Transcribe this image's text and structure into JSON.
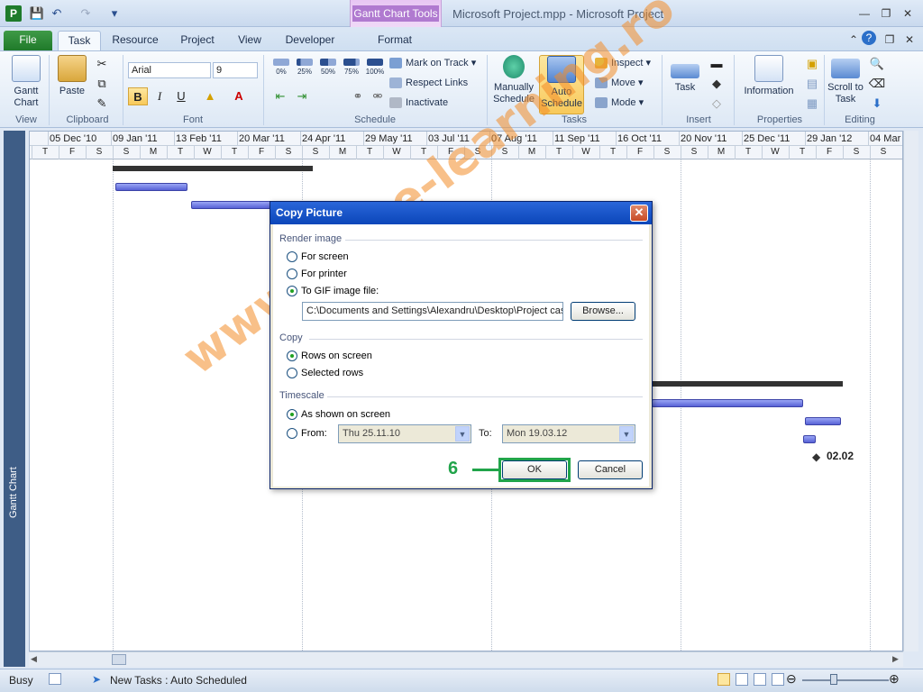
{
  "app": {
    "title": "Microsoft Project.mpp  -  Microsoft Project",
    "logo_letter": "P",
    "context_tab_group": "Gantt Chart Tools"
  },
  "tabs": [
    "File",
    "Task",
    "Resource",
    "Project",
    "View",
    "Developer",
    "Format"
  ],
  "ribbon": {
    "view": {
      "gantt_chart": "Gantt Chart",
      "group": "View"
    },
    "clipboard": {
      "paste": "Paste",
      "group": "Clipboard"
    },
    "font": {
      "font_name": "Arial",
      "font_size": "9",
      "bold": "B",
      "italic": "I",
      "underline": "U",
      "group": "Font"
    },
    "schedule": {
      "percent_buttons": [
        "0%",
        "25%",
        "50%",
        "75%",
        "100%"
      ],
      "mark_on_track": "Mark on Track",
      "respect_links": "Respect Links",
      "inactivate": "Inactivate",
      "group": "Schedule"
    },
    "tasks": {
      "manually_schedule": "Manually Schedule",
      "auto_schedule": "Auto Schedule",
      "inspect": "Inspect",
      "move": "Move",
      "mode": "Mode",
      "group": "Tasks"
    },
    "insert": {
      "task": "Task",
      "group": "Insert"
    },
    "properties": {
      "information": "Information",
      "group": "Properties"
    },
    "editing": {
      "scroll_to_task": "Scroll to Task",
      "group": "Editing"
    }
  },
  "view_bar_label": "Gantt Chart",
  "timescale": {
    "top": [
      "05 Dec '10",
      "09 Jan '11",
      "13 Feb '11",
      "20 Mar '11",
      "24 Apr '11",
      "29 May '11",
      "03 Jul '11",
      "07 Aug '11",
      "11 Sep '11",
      "16 Oct '11",
      "20 Nov '11",
      "25 Dec '11",
      "29 Jan '12",
      "04 Mar"
    ],
    "bottom": [
      "T",
      "F",
      "S",
      "S",
      "M",
      "T",
      "W",
      "T",
      "F",
      "S",
      "S",
      "M",
      "T",
      "W",
      "T",
      "F",
      "S",
      "S",
      "M",
      "T",
      "W",
      "T",
      "F",
      "S",
      "S",
      "M",
      "T",
      "W",
      "T",
      "F",
      "S",
      "S"
    ]
  },
  "milestone_label": "02.02",
  "dialog": {
    "title": "Copy Picture",
    "render_image": {
      "label": "Render image",
      "options": [
        "For screen",
        "For printer",
        "To GIF image file:"
      ],
      "selected": 2,
      "path": "C:\\Documents and Settings\\Alexandru\\Desktop\\Project cas",
      "browse": "Browse..."
    },
    "copy": {
      "label": "Copy",
      "options": [
        "Rows on screen",
        "Selected rows"
      ],
      "selected": 0
    },
    "timescale": {
      "label": "Timescale",
      "options": [
        "As shown on screen",
        "From:"
      ],
      "selected": 0,
      "from_value": "Thu 25.11.10",
      "to_label": "To:",
      "to_value": "Mon 19.03.12"
    },
    "ok": "OK",
    "cancel": "Cancel"
  },
  "step_marker": "6",
  "watermark": "www.office-learning.ro",
  "status": {
    "mode": "Busy",
    "new_tasks": "New Tasks : Auto Scheduled"
  },
  "colors": {
    "accent_green": "#21a44a",
    "task_bar": "#5761d6",
    "file_tab": "#1f7a2a"
  }
}
